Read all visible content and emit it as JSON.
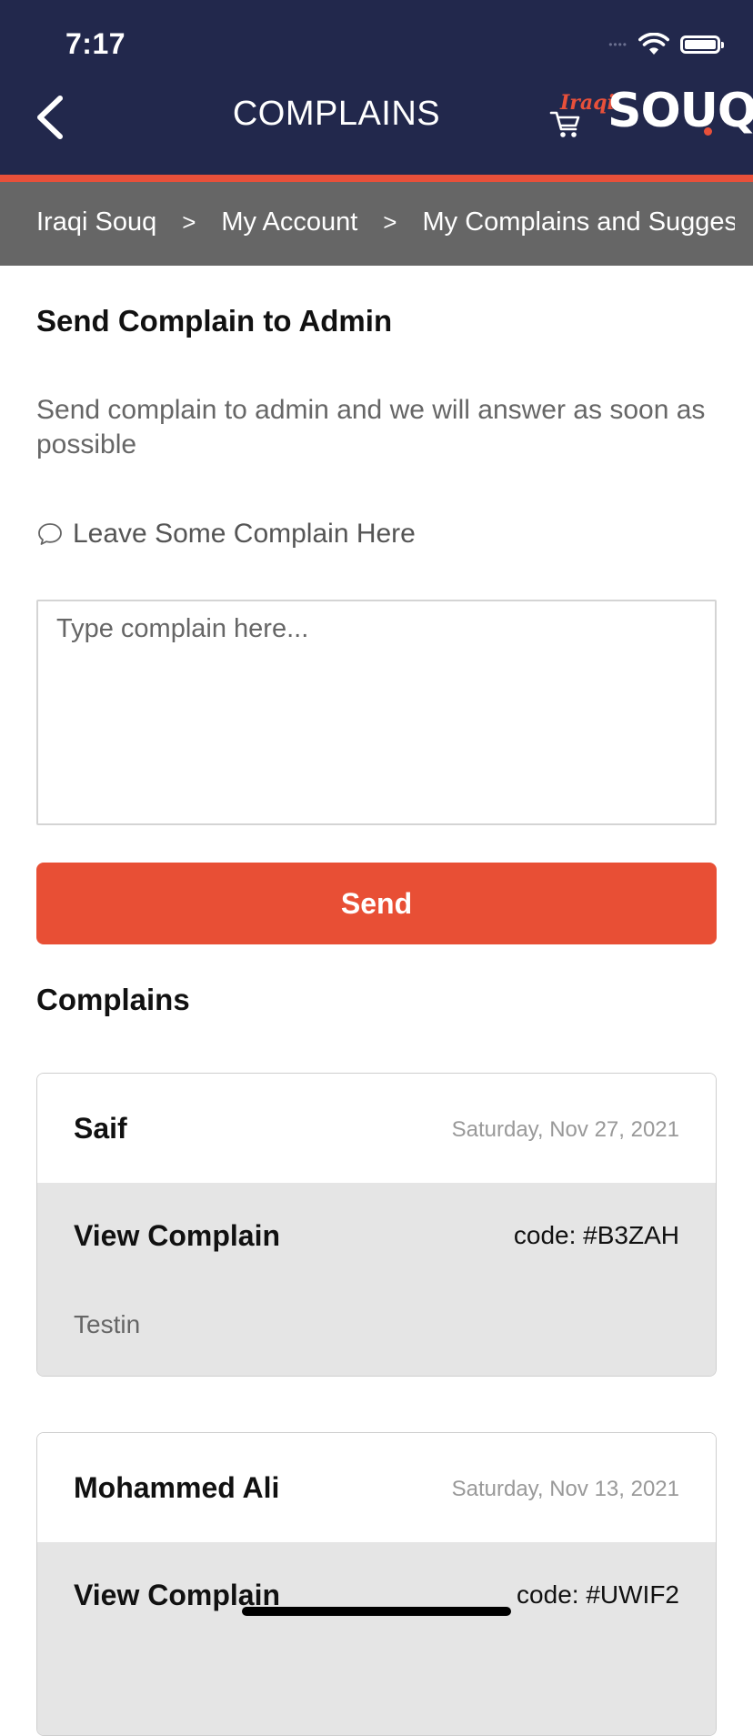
{
  "status_bar": {
    "time": "7:17"
  },
  "header": {
    "title": "COMPLAINS",
    "logo_prefix": "Iraqi",
    "logo_name": "SOUQ"
  },
  "breadcrumb": {
    "items": [
      "Iraqi Souq",
      "My Account",
      "My Complains and Suggestions"
    ],
    "separator": ">"
  },
  "main": {
    "section_title": "Send Complain to Admin",
    "description": "Send complain to admin and we will answer as soon as possible",
    "leave_label": "Leave Some Complain Here",
    "input": {
      "placeholder": "Type complain here...",
      "value": ""
    },
    "send_label": "Send",
    "list_title": "Complains"
  },
  "complains": [
    {
      "author": "Saif",
      "date": "Saturday, Nov 27, 2021",
      "view_label": "View Complain",
      "code": "code: #B3ZAH",
      "text": "Testin"
    },
    {
      "author": "Mohammed Ali",
      "date": "Saturday, Nov 13, 2021",
      "view_label": "View Complain",
      "code": "code: #UWIF2",
      "text": ""
    }
  ],
  "colors": {
    "header_bg": "#22284c",
    "accent": "#e8503a",
    "breadcrumb_bg": "#666666",
    "card_body_bg": "#e5e5e5"
  }
}
